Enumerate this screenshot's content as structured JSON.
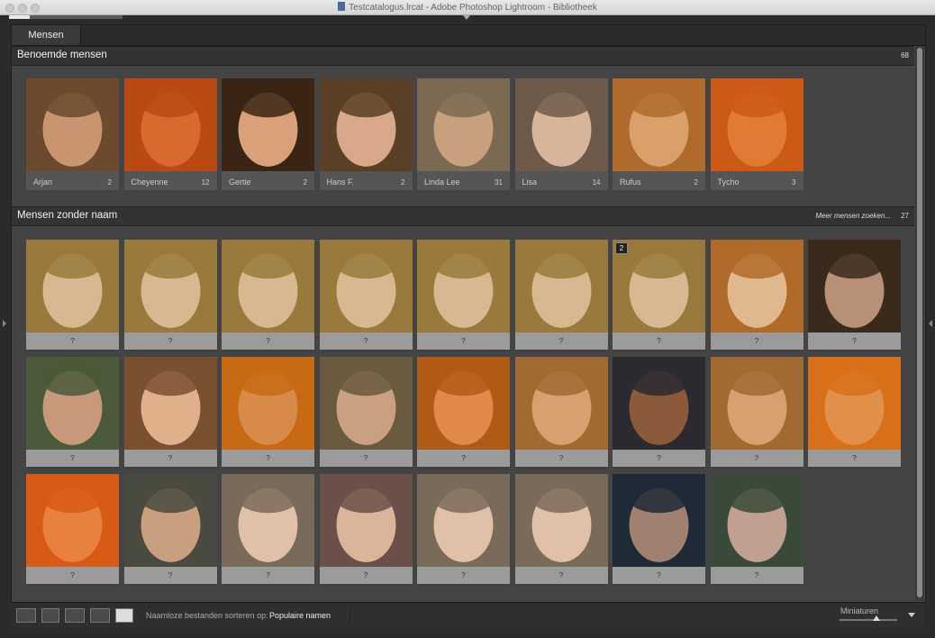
{
  "window": {
    "title": "Testcatalogus.lrcat - Adobe Photoshop Lightroom - Bibliotheek",
    "progress": 0.18
  },
  "tab": {
    "label": "Mensen"
  },
  "named_section": {
    "title": "Benoemde mensen",
    "count": "68",
    "people": [
      {
        "name": "Arjan",
        "count": "2",
        "tone": "#6b4a2e",
        "skin": "#c99470"
      },
      {
        "name": "Cheyenne",
        "count": "12",
        "tone": "#b94a14",
        "skin": "#d86a30"
      },
      {
        "name": "Gertie",
        "count": "2",
        "tone": "#3a2414",
        "skin": "#d9a07a"
      },
      {
        "name": "Hans F.",
        "count": "2",
        "tone": "#5a4026",
        "skin": "#d8a888"
      },
      {
        "name": "Linda Lee",
        "count": "31",
        "tone": "#7a6a52",
        "skin": "#c8a07e"
      },
      {
        "name": "Lisa",
        "count": "14",
        "tone": "#6e5a4a",
        "skin": "#d8b49a"
      },
      {
        "name": "Rufus",
        "count": "2",
        "tone": "#b06a2c",
        "skin": "#d9a06a"
      },
      {
        "name": "Tycho",
        "count": "3",
        "tone": "#cc5a16",
        "skin": "#e07a34"
      }
    ]
  },
  "unnamed_section": {
    "title": "Mensen zonder naam",
    "link": "Meer mensen zoeken...",
    "count": "27",
    "unknown_label": "?",
    "stack_badge": "2",
    "faces": [
      {
        "tone": "#9a7a3c",
        "skin": "#d8b890"
      },
      {
        "tone": "#9a7a3c",
        "skin": "#d8b890"
      },
      {
        "tone": "#9a7a3c",
        "skin": "#d8b890"
      },
      {
        "tone": "#9a7a3c",
        "skin": "#d8b890"
      },
      {
        "tone": "#9a7a3c",
        "skin": "#d8b890"
      },
      {
        "tone": "#9a7a3c",
        "skin": "#d8b890"
      },
      {
        "tone": "#9a7a3c",
        "skin": "#d8b890"
      },
      {
        "tone": "#b06a2a",
        "skin": "#e0b890"
      },
      {
        "tone": "#3a2a1c",
        "skin": "#b89078"
      },
      {
        "tone": "#4a5a3a",
        "skin": "#c8987a"
      },
      {
        "tone": "#7a5030",
        "skin": "#e0b08a"
      },
      {
        "tone": "#c86a14",
        "skin": "#d88a4a"
      },
      {
        "tone": "#6a5a40",
        "skin": "#caa080"
      },
      {
        "tone": "#b05a18",
        "skin": "#e08a4a"
      },
      {
        "tone": "#a06a30",
        "skin": "#d8a070"
      },
      {
        "tone": "#2a2a30",
        "skin": "#8a5a3a"
      },
      {
        "tone": "#a06a30",
        "skin": "#d8a070"
      },
      {
        "tone": "#d8701a",
        "skin": "#e0904a"
      },
      {
        "tone": "#d85a14",
        "skin": "#e88040"
      },
      {
        "tone": "#4a4a40",
        "skin": "#c8a080"
      },
      {
        "tone": "#7a6a5a",
        "skin": "#e0c0a8"
      },
      {
        "tone": "#6a5048",
        "skin": "#dcb49a"
      },
      {
        "tone": "#7a6a5a",
        "skin": "#e0c0a8"
      },
      {
        "tone": "#7a6a5a",
        "skin": "#e0c0a8"
      },
      {
        "tone": "#1e2a36",
        "skin": "#a08070"
      },
      {
        "tone": "#3a4a3a",
        "skin": "#c0a090"
      }
    ]
  },
  "toolbar": {
    "sort_label": "Naamloze bestanden sorteren op:",
    "sort_value": "Populaire namen",
    "thumbnail_label": "Miniaturen"
  }
}
